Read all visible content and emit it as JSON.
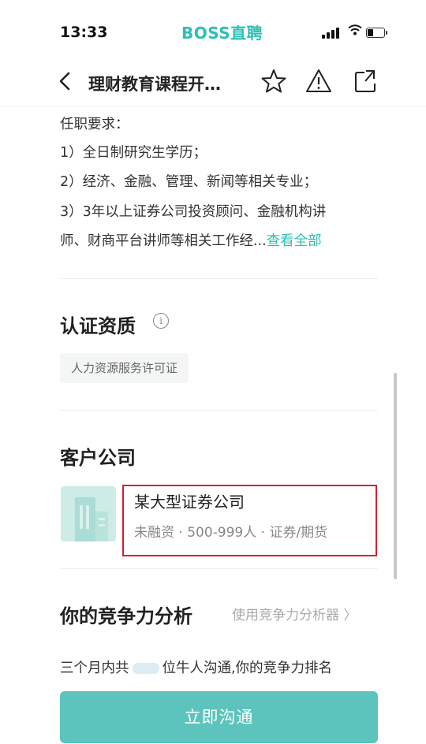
{
  "status_bar": {
    "time": "13:33",
    "brand": "BOSS直聘"
  },
  "nav": {
    "title": "理财教育课程开…"
  },
  "requirements": {
    "heading": "任职要求：",
    "lines": [
      "1）全日制研究生学历；",
      "2）经济、金融、管理、新闻等相关专业；",
      "3）3年以上证券公司投资顾问、金融机构讲",
      "师、财商平台讲师等相关工作经..."
    ],
    "view_all": "查看全部"
  },
  "certification": {
    "title": "认证资质",
    "info_icon": "i",
    "tag": "人力资源服务许可证"
  },
  "client": {
    "title": "客户公司",
    "company_name": "某大型证券公司",
    "company_meta": "未融资 · 500-999人 · 证券/期货"
  },
  "competitiveness": {
    "title": "你的竞争力分析",
    "analyzer_link": "使用竞争力分析器 〉",
    "sentence_prefix": "三个月内共",
    "sentence_suffix": "位牛人沟通,你的竞争力排名"
  },
  "cta": {
    "label": "立即沟通"
  },
  "colors": {
    "brand": "#2bc0b4",
    "cta_bg": "#5cc4bc",
    "highlight_border": "#d81e2e"
  }
}
